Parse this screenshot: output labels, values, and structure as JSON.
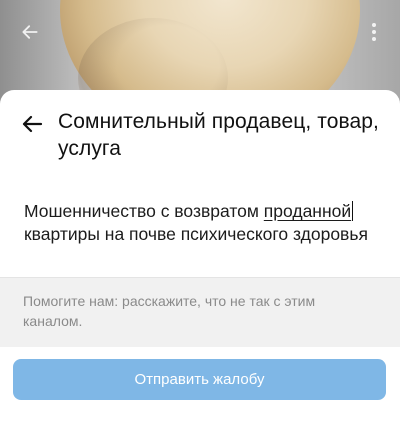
{
  "header": {
    "title": "Сомнительный продавец, товар, услуга",
    "back_icon": "arrow-left-icon"
  },
  "topbar": {
    "back_icon": "arrow-left-icon",
    "more_icon": "vertical-dots-icon"
  },
  "report": {
    "text_before": "Мошенничество с возвратом ",
    "text_underlined": "проданной",
    "text_after": " квартиры на почве психического здоровья"
  },
  "hint": {
    "text": "Помогите нам: расскажите, что не так с этим каналом."
  },
  "footer": {
    "submit_label": "Отправить жалобу"
  },
  "colors": {
    "submit_button": "#7fb7e6",
    "hint_background": "#f1f1f1",
    "hint_text": "#8a8a8a"
  }
}
